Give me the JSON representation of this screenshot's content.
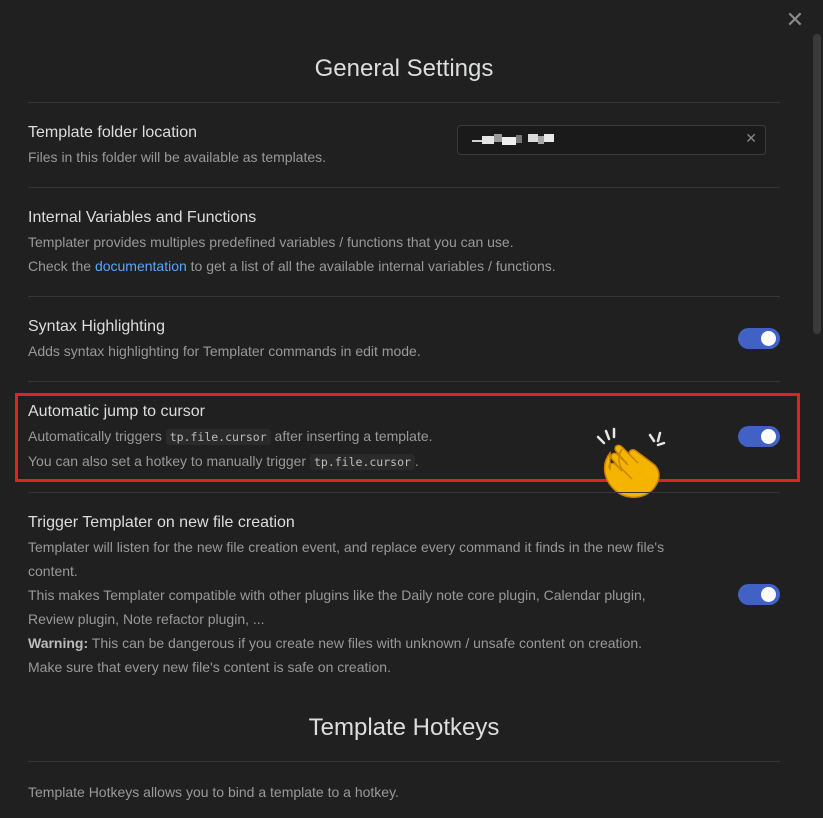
{
  "modal": {
    "close_glyph": "✕"
  },
  "general": {
    "title": "General Settings"
  },
  "template_folder": {
    "name": "Template folder location",
    "desc": "Files in this folder will be available as templates.",
    "input_value": "",
    "clear_glyph": "✕"
  },
  "internal_vars": {
    "name": "Internal Variables and Functions",
    "desc1": "Templater provides multiples predefined variables / functions that you can use.",
    "desc2_before": "Check the ",
    "desc2_link": "documentation",
    "desc2_after": " to get a list of all the available internal variables / functions."
  },
  "syntax_highlighting": {
    "name": "Syntax Highlighting",
    "desc": "Adds syntax highlighting for Templater commands in edit mode.",
    "enabled": true
  },
  "jump_cursor": {
    "name": "Automatic jump to cursor",
    "desc1_before": "Automatically triggers ",
    "desc1_code": "tp.file.cursor",
    "desc1_after": " after inserting a template.",
    "desc2_before": "You can also set a hotkey to manually trigger ",
    "desc2_code": "tp.file.cursor",
    "desc2_after": ".",
    "enabled": true
  },
  "trigger_new_file": {
    "name": "Trigger Templater on new file creation",
    "desc1": "Templater will listen for the new file creation event, and replace every command it finds in the new file's",
    "desc2": "content.",
    "desc3": "This makes Templater compatible with other plugins like the Daily note core plugin, Calendar plugin,",
    "desc4": "Review plugin, Note refactor plugin, ...",
    "desc5_bold": "Warning:",
    "desc5_rest": " This can be dangerous if you create new files with unknown / unsafe content on creation.",
    "desc6": "Make sure that every new file's content is safe on creation.",
    "enabled": true
  },
  "hotkeys": {
    "title": "Template Hotkeys",
    "desc": "Template Hotkeys allows you to bind a template to a hotkey."
  },
  "colors": {
    "background": "#202020",
    "toggle_on": "#4161c4",
    "link": "#58a6ff",
    "highlight": "#e0202b"
  },
  "icons": {
    "close": "close-icon",
    "clear": "clear-input-icon",
    "emoji": "clapping-hands-icon"
  }
}
